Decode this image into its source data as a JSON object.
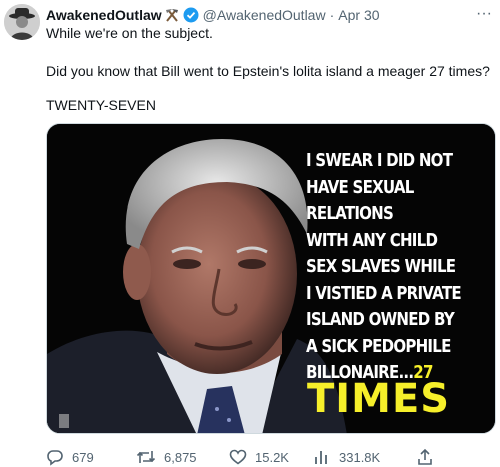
{
  "tweet": {
    "display_name": "AwakenedOutlaw",
    "emoji": "⚒",
    "handle": "@AwakenedOutlaw",
    "separator": "·",
    "date": "Apr 30",
    "more": "···",
    "lines": [
      "While we're on the subject.",
      "Did you know that Bill went to Epstein's lolita island a meager 27 times?",
      "TWENTY-SEVEN"
    ]
  },
  "media": {
    "caption_lines": [
      "I SWEAR I DID NOT",
      "HAVE SEXUAL",
      "RELATIONS",
      "WITH ANY CHILD",
      "SEX SLAVES WHILE",
      "I VISTIED A PRIVATE",
      "ISLAND OWNED BY",
      "A SICK PEDOPHILE"
    ],
    "caption_last_prefix": "BILLONAIRE...",
    "caption_last_highlight": "27",
    "caption_big": "TIMES",
    "colors": {
      "caption_white": "#ffffff",
      "caption_yellow": "#f6ef2a",
      "background": "#050505"
    }
  },
  "actions": {
    "replies": "679",
    "reposts": "6,875",
    "likes": "15.2K",
    "views": "331.8K",
    "icons": [
      "reply-icon",
      "repost-icon",
      "like-icon",
      "views-icon",
      "share-icon"
    ]
  },
  "colors": {
    "verified": "#1d9bf0",
    "secondary_text": "#536471"
  }
}
